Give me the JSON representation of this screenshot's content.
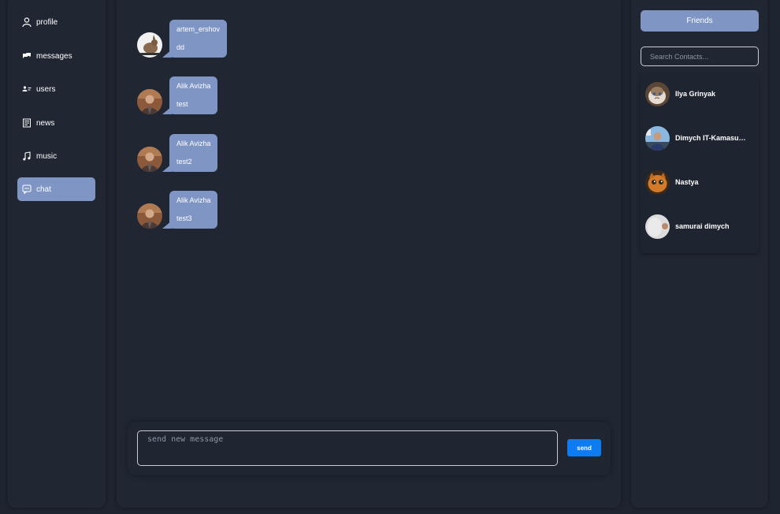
{
  "sidebar": {
    "items": [
      {
        "label": "profile",
        "icon": "user-icon"
      },
      {
        "label": "messages",
        "icon": "messages-icon"
      },
      {
        "label": "users",
        "icon": "users-icon"
      },
      {
        "label": "news",
        "icon": "news-icon"
      },
      {
        "label": "music",
        "icon": "music-icon"
      },
      {
        "label": "chat",
        "icon": "chat-icon",
        "active": true
      }
    ]
  },
  "chat": {
    "messages": [
      {
        "author": "artem_ershov",
        "text": "dd"
      },
      {
        "author": "Alik Avizha",
        "text": "test"
      },
      {
        "author": "Alik Avizha",
        "text": "test2"
      },
      {
        "author": "Alik Avizha",
        "text": "test3"
      }
    ],
    "input_placeholder": "send new message",
    "send_label": "send"
  },
  "friends": {
    "button_label": "Friends",
    "search_placeholder": "Search Contacts...",
    "contacts": [
      {
        "name": "Ilya Grinyak"
      },
      {
        "name": "Dimych IT-Kamasutra"
      },
      {
        "name": "Nastya"
      },
      {
        "name": "samurai dimych"
      }
    ]
  },
  "colors": {
    "accent": "#7f95c4",
    "send_button": "#0d7cf2",
    "panel": "#202733",
    "background": "#1e2430"
  }
}
